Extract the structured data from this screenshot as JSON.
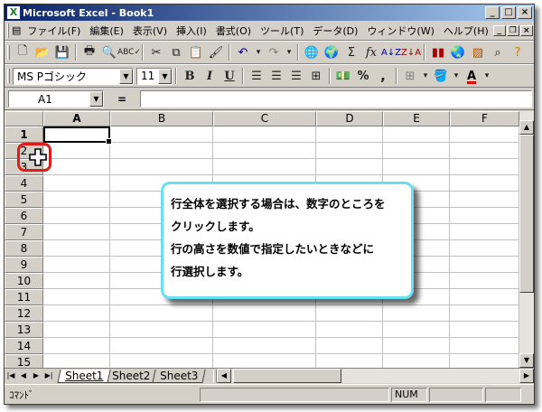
{
  "window": {
    "title": "Microsoft Excel - Book1",
    "app_icon": "X",
    "controls": [
      "minimize-icon",
      "maximize-icon",
      "close-icon"
    ]
  },
  "menu": {
    "items": [
      "ファイル(F)",
      "編集(E)",
      "表示(V)",
      "挿入(I)",
      "書式(O)",
      "ツール(T)",
      "データ(D)",
      "ウィンドウ(W)",
      "ヘルプ(H)"
    ]
  },
  "toolbar_standard": {
    "icons": [
      "new-icon",
      "open-icon",
      "save-icon",
      "print-icon",
      "print-preview-icon",
      "spelling-icon",
      "cut-icon",
      "copy-icon",
      "paste-icon",
      "format-painter-icon",
      "undo-icon",
      "redo-icon",
      "hyperlink-icon",
      "web-toolbar-icon",
      "autosum-icon",
      "function-icon",
      "sort-ascending-icon",
      "sort-descending-icon",
      "chart-wizard-icon",
      "map-icon",
      "office-assistant-icon"
    ],
    "autosum_glyph": "Σ",
    "function_glyph": "fx"
  },
  "toolbar_format": {
    "font_name": "MS Pゴシック",
    "font_size": "11",
    "bold": "B",
    "italic": "I",
    "underline": "U",
    "currency": "%",
    "comma": ",",
    "font_color_glyph": "A"
  },
  "formula_bar": {
    "name_box": "A1",
    "equals": "=",
    "formula": ""
  },
  "grid": {
    "columns": [
      "A",
      "B",
      "C",
      "D",
      "E",
      "F"
    ],
    "rows": [
      "1",
      "2",
      "3",
      "4",
      "5",
      "6",
      "7",
      "8",
      "9",
      "10",
      "11",
      "12",
      "13",
      "14",
      "15"
    ],
    "active_cell": "A1",
    "active_column": "A",
    "active_row": "1"
  },
  "callout": {
    "line1": "行全体を選択する場合は、数字のところを",
    "line2": "クリックします。",
    "line3": "行の高さを数値で指定したいときなどに",
    "line4": "行選択します。",
    "border_color": "#66e0f2"
  },
  "highlight": {
    "target_row": "2",
    "color": "#e01b1b"
  },
  "sheets": {
    "tabs": [
      "Sheet1",
      "Sheet2",
      "Sheet3"
    ],
    "active": "Sheet1"
  },
  "status": {
    "mode": "ｺﾏﾝﾄﾞ",
    "num_lock": "NUM"
  }
}
